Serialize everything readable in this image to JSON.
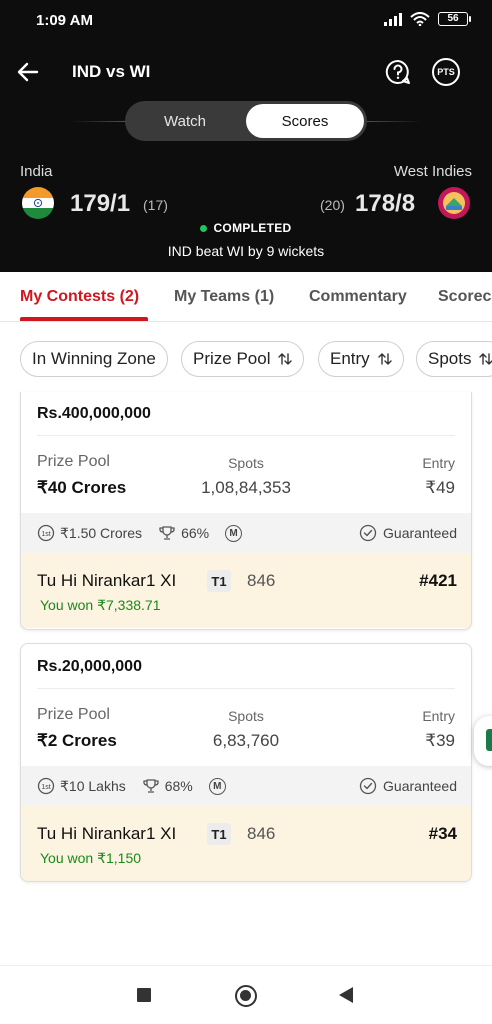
{
  "status_bar": {
    "time": "1:09 AM",
    "battery": "56"
  },
  "header": {
    "title": "IND vs WI",
    "pts_label": "PTS",
    "toggle": {
      "watch": "Watch",
      "scores": "Scores"
    }
  },
  "match": {
    "team_left": {
      "name": "India",
      "score": "179/1",
      "overs": "(17)"
    },
    "team_right": {
      "name": "West Indies",
      "score": "178/8",
      "overs": "(20)"
    },
    "status": "COMPLETED",
    "result": "IND beat WI by 9 wickets"
  },
  "tabs": [
    {
      "label": "My Contests (2)"
    },
    {
      "label": "My Teams (1)"
    },
    {
      "label": "Commentary"
    },
    {
      "label": "Scorecard"
    }
  ],
  "filters": [
    {
      "label": "In Winning Zone"
    },
    {
      "label": "Prize Pool"
    },
    {
      "label": "Entry"
    },
    {
      "label": "Spots"
    }
  ],
  "contests": [
    {
      "title": "Rs.400,000,000",
      "prize_pool_label": "Prize Pool",
      "prize_pool": "₹40 Crores",
      "spots_label": "Spots",
      "spots": "1,08,84,353",
      "entry_label": "Entry",
      "entry": "₹49",
      "first_prize": "₹1.50 Crores",
      "win_percent": "66%",
      "multi_badge": "M",
      "guaranteed": "Guaranteed",
      "team_name": "Tu Hi Nirankar1 XI",
      "team_tag": "T1",
      "points": "846",
      "rank": "#421",
      "won": "You won ₹7,338.71"
    },
    {
      "title": "Rs.20,000,000",
      "prize_pool_label": "Prize Pool",
      "prize_pool": "₹2 Crores",
      "spots_label": "Spots",
      "spots": "6,83,760",
      "entry_label": "Entry",
      "entry": "₹39",
      "first_prize": "₹10 Lakhs",
      "win_percent": "68%",
      "multi_badge": "M",
      "guaranteed": "Guaranteed",
      "team_name": "Tu Hi Nirankar1 XI",
      "team_tag": "T1",
      "points": "846",
      "rank": "#34",
      "won": "You won ₹1,150"
    }
  ],
  "colors": {
    "accent": "#d0161f",
    "header_bg": "#0d0d0d",
    "win_green": "#1a8a1a",
    "team_bar_bg": "#fdf3e1"
  }
}
